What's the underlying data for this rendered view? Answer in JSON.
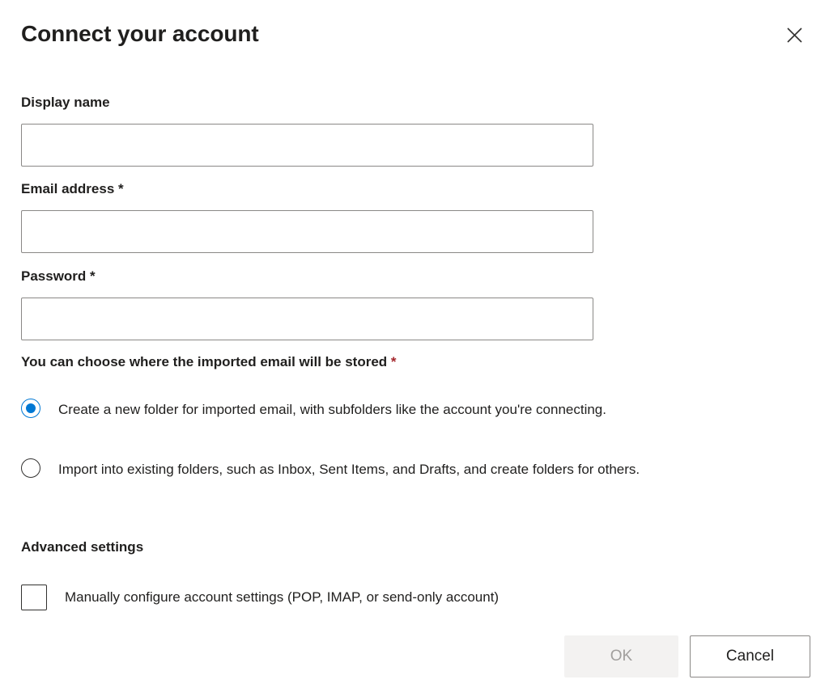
{
  "dialog": {
    "title": "Connect your account",
    "close_icon": "close-icon",
    "close_label": "Close"
  },
  "form": {
    "display_name": {
      "label": "Display name",
      "value": "",
      "placeholder": "",
      "required": false,
      "required_marker": ""
    },
    "email_address": {
      "label": "Email address",
      "value": "",
      "placeholder": "",
      "required": true,
      "required_marker": "*"
    },
    "password": {
      "label": "Password",
      "value": "",
      "placeholder": "",
      "required": true,
      "required_marker": "*"
    }
  },
  "storage_choice": {
    "label": "You can choose where the imported email will be stored",
    "required_marker": "*",
    "required_marker_color": "#a4262c",
    "selected_index": 0,
    "options": [
      {
        "label": "Create a new folder for imported email, with subfolders like the account you're connecting.",
        "selected": true
      },
      {
        "label": "Import into existing folders, such as Inbox, Sent Items, and Drafts, and create folders for others.",
        "selected": false
      }
    ]
  },
  "advanced_settings": {
    "heading": "Advanced settings",
    "checkbox": {
      "label": "Manually configure account settings (POP, IMAP, or send-only account)",
      "checked": false
    }
  },
  "footer": {
    "ok_label": "OK",
    "ok_disabled": true,
    "cancel_label": "Cancel"
  },
  "colors": {
    "accent": "#0078d4",
    "required_red": "#a4262c",
    "text": "#201f1e",
    "border": "#8a8886",
    "disabled_bg": "#f3f2f1",
    "disabled_text": "#a19f9d",
    "background": "#ffffff"
  }
}
